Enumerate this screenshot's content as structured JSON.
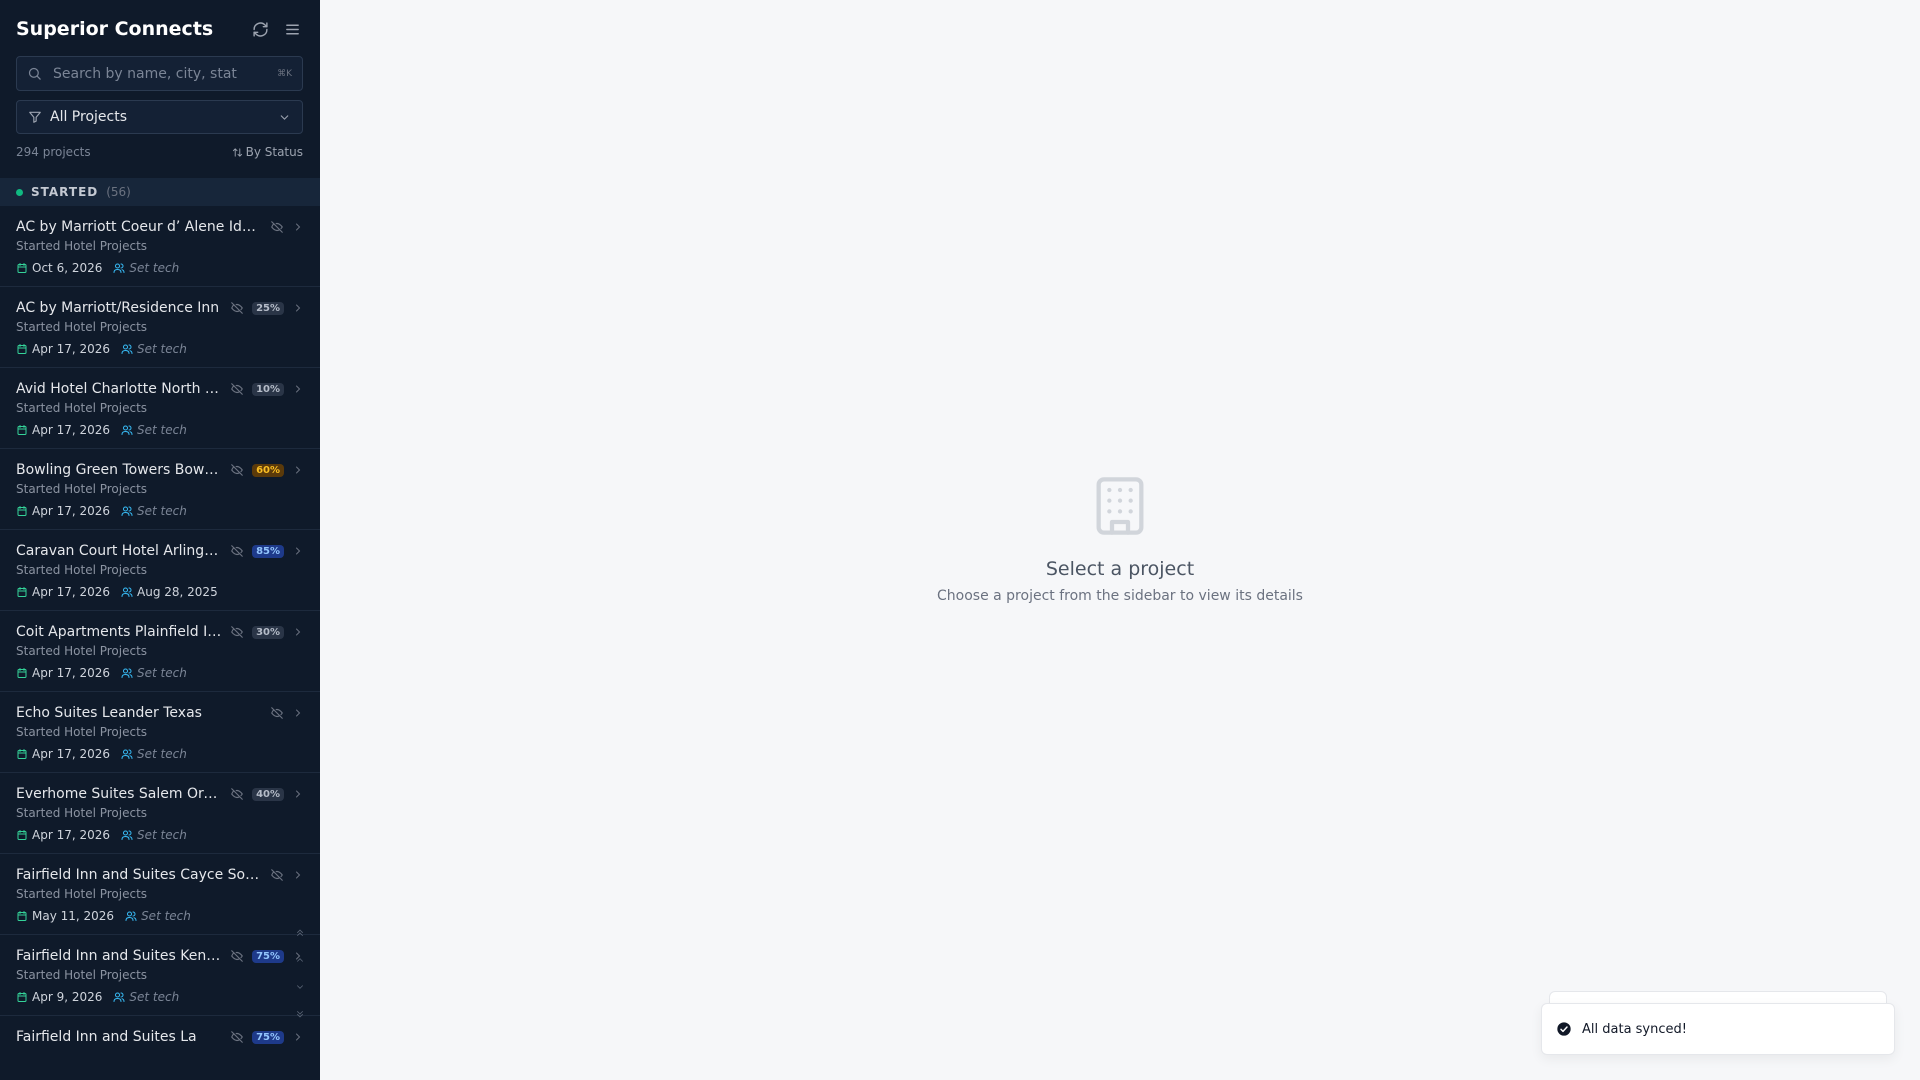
{
  "app": {
    "title": "Superior Connects"
  },
  "search": {
    "placeholder": "Search by name, city, stat",
    "shortcut": "⌘K"
  },
  "filter": {
    "label": "All Projects"
  },
  "summary": {
    "count_text": "294 projects",
    "sort_label": "By Status"
  },
  "group": {
    "label": "STARTED",
    "count": "(56)",
    "color": "#10b981"
  },
  "projects": [
    {
      "name": "AC by Marriott Coeur d’ Alene Idaho",
      "category": "Started Hotel Projects",
      "date": "Oct 6, 2026",
      "tech": "Set tech",
      "tech_set": false,
      "percent": ""
    },
    {
      "name": "AC by Marriott/Residence Inn",
      "category": "Started Hotel Projects",
      "date": "Apr 17, 2026",
      "tech": "Set tech",
      "tech_set": false,
      "percent": "25%"
    },
    {
      "name": "Avid Hotel Charlotte North Carolina",
      "category": "Started Hotel Projects",
      "date": "Apr 17, 2026",
      "tech": "Set tech",
      "tech_set": false,
      "percent": "10%"
    },
    {
      "name": "Bowling Green Towers Bowling Green",
      "category": "Started Hotel Projects",
      "date": "Apr 17, 2026",
      "tech": "Set tech",
      "tech_set": false,
      "percent": "60%"
    },
    {
      "name": "Caravan Court Hotel Arlington",
      "category": "Started Hotel Projects",
      "date": "Apr 17, 2026",
      "tech": "Aug 28, 2025",
      "tech_set": true,
      "percent": "85%"
    },
    {
      "name": "Coit Apartments Plainfield Indiana",
      "category": "Started Hotel Projects",
      "date": "Apr 17, 2026",
      "tech": "Set tech",
      "tech_set": false,
      "percent": "30%"
    },
    {
      "name": "Echo Suites Leander Texas",
      "category": "Started Hotel Projects",
      "date": "Apr 17, 2026",
      "tech": "Set tech",
      "tech_set": false,
      "percent": ""
    },
    {
      "name": "Everhome Suites Salem Oregon",
      "category": "Started Hotel Projects",
      "date": "Apr 17, 2026",
      "tech": "Set tech",
      "tech_set": false,
      "percent": "40%"
    },
    {
      "name": "Fairfield Inn and Suites Cayce South Carolina",
      "category": "Started Hotel Projects",
      "date": "May 11, 2026",
      "tech": "Set tech",
      "tech_set": false,
      "percent": ""
    },
    {
      "name": "Fairfield Inn and Suites Kentucky",
      "category": "Started Hotel Projects",
      "date": "Apr 9, 2026",
      "tech": "Set tech",
      "tech_set": false,
      "percent": "75%"
    },
    {
      "name": "Fairfield Inn and Suites La",
      "category": "Started Hotel Projects",
      "date": "",
      "tech": "",
      "tech_set": false,
      "percent": "75%"
    }
  ],
  "empty_state": {
    "title": "Select a project",
    "subtitle": "Choose a project from the sidebar to view its details"
  },
  "toast": {
    "message": "All data synced!"
  },
  "colors": {
    "sidebar_bg": "#0f1a2a",
    "accent_green": "#10b981",
    "accent_blue": "#38bdf8"
  }
}
